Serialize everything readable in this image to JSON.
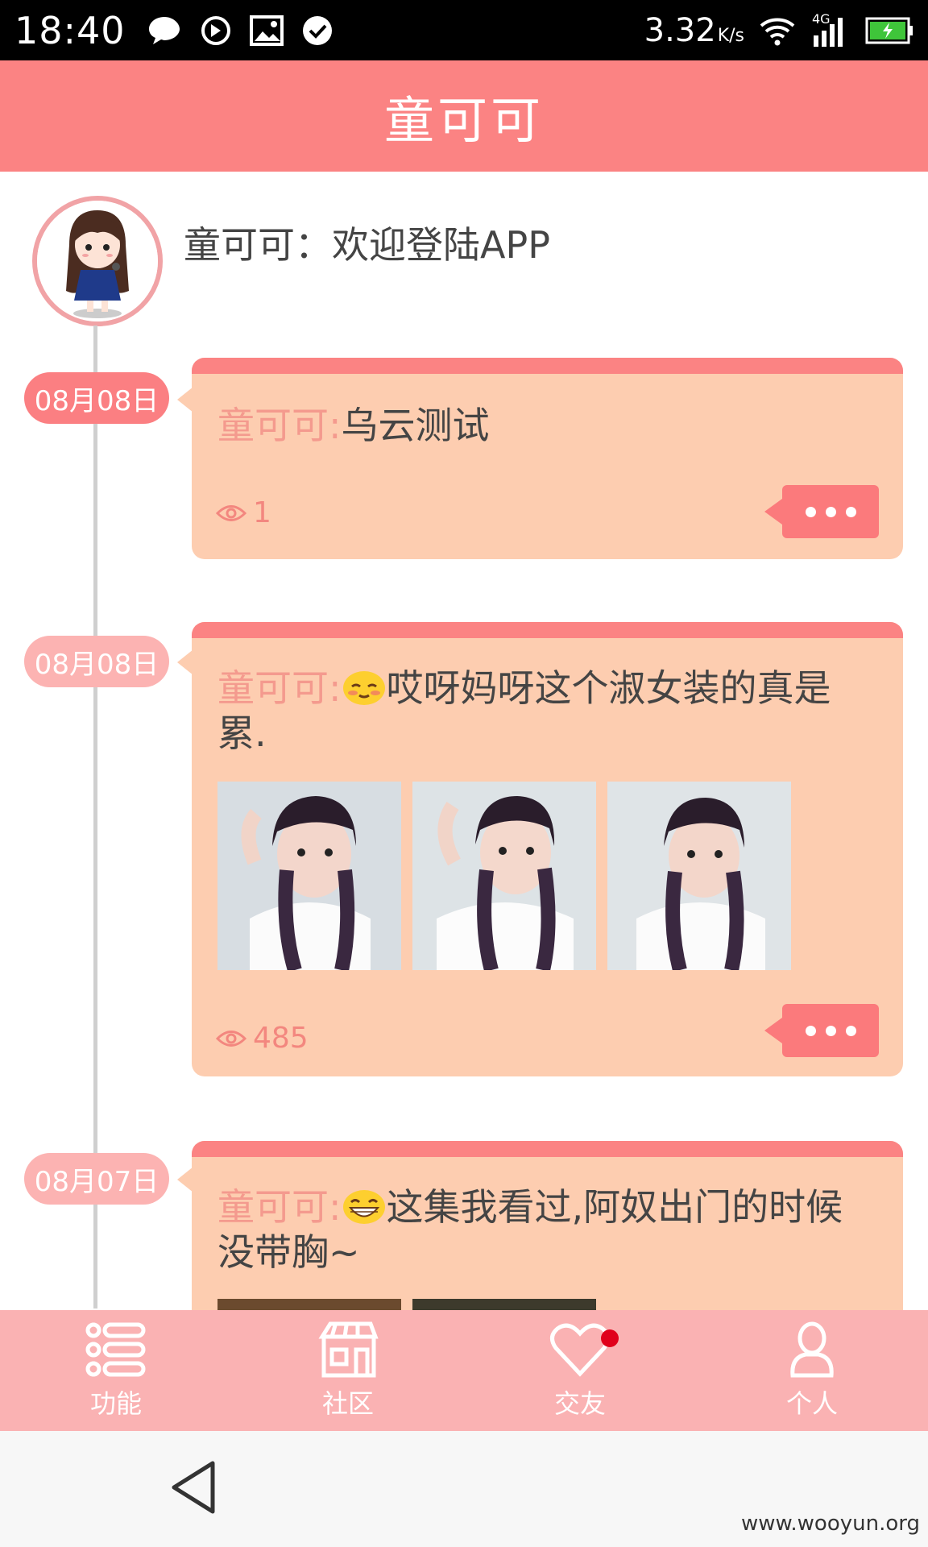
{
  "status_bar": {
    "time": "18:40",
    "speed": "3.32",
    "speed_unit": "K/s",
    "network": "4G",
    "icons": [
      "chat-icon",
      "sync-icon",
      "image-icon",
      "check-icon",
      "wifi-icon",
      "signal-icon",
      "battery-icon"
    ]
  },
  "header": {
    "title": "童可可"
  },
  "profile": {
    "welcome": "童可可：欢迎登陆APP"
  },
  "posts": [
    {
      "date": "08月08日",
      "author": "童可可:",
      "text": "乌云测试",
      "views": "1",
      "emoji": "",
      "photos": []
    },
    {
      "date": "08月08日",
      "author": "童可可:",
      "text": "哎呀妈呀这个淑女装的真是累.",
      "views": "485",
      "emoji": "shy-face-emoji",
      "photos": [
        "photo-girl-braids-1",
        "photo-girl-braids-2",
        "photo-girl-braids-3"
      ]
    },
    {
      "date": "08月07日",
      "author": "童可可:",
      "text": "这集我看过,阿奴出门的时候没带胸~",
      "views": "",
      "emoji": "grin-face-emoji",
      "photos": [
        "photo-partial-1",
        "photo-partial-2"
      ]
    }
  ],
  "bottom_nav": [
    {
      "label": "功能",
      "icon": "menu-list-icon"
    },
    {
      "label": "社区",
      "icon": "storefront-icon"
    },
    {
      "label": "交友",
      "icon": "heart-icon",
      "has_badge": true
    },
    {
      "label": "个人",
      "icon": "person-icon"
    }
  ],
  "watermark": "www.wooyun.org",
  "colors": {
    "accent": "#fb8383",
    "card_bg": "#fdcdb0",
    "nav_bg": "#fab2b3",
    "date_badge_active": "#fb7f82",
    "date_badge_inactive": "#fcb3b2"
  }
}
